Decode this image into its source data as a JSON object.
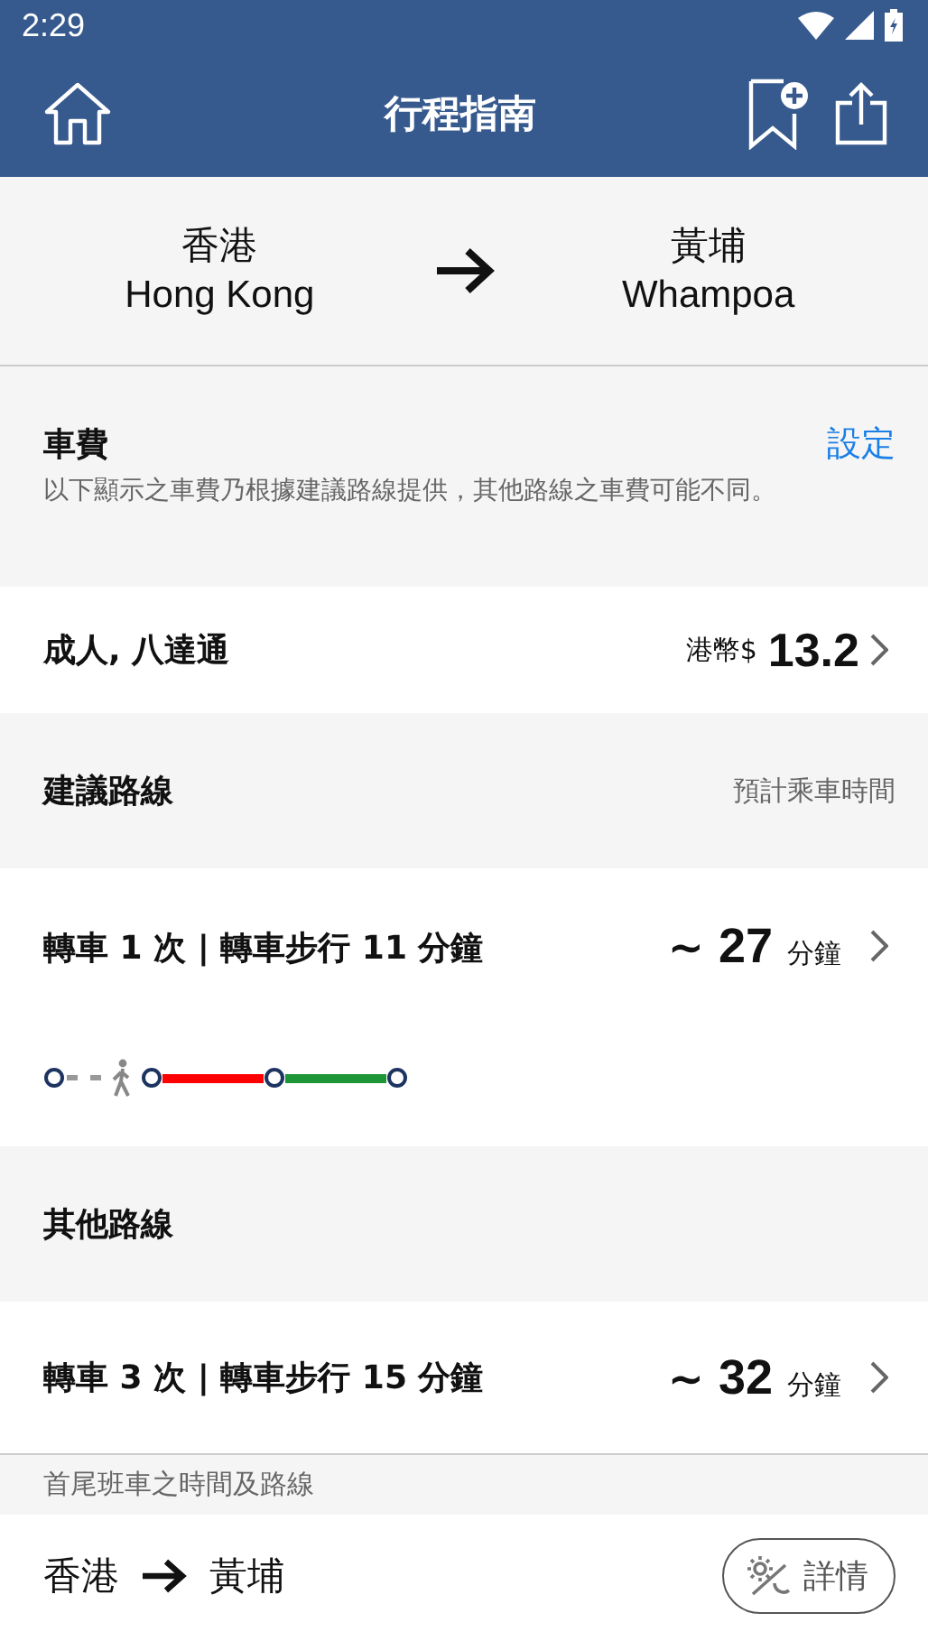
{
  "status_bar": {
    "time": "2:29"
  },
  "app_bar": {
    "title": "行程指南"
  },
  "journey": {
    "origin_zh": "香港",
    "origin_en": "Hong Kong",
    "destination_zh": "黃埔",
    "destination_en": "Whampoa"
  },
  "fare": {
    "title": "車費",
    "action": "設定",
    "note": "以下顯示之車費乃根據建議路線提供，其他路線之車費可能不同。",
    "passenger": "成人, 八達通",
    "currency": "港幣$",
    "amount": "13.2"
  },
  "suggested": {
    "title": "建議路線",
    "hint": "預計乘車時間",
    "route": {
      "summary": "轉車 1 次 | 轉車步行 11 分鐘",
      "prefix": "~",
      "minutes": "27",
      "unit": "分鐘",
      "segments": [
        {
          "kind": "walk"
        },
        {
          "kind": "rail",
          "color": "#ff0000"
        },
        {
          "kind": "rail",
          "color": "#1e9638"
        }
      ]
    }
  },
  "other": {
    "title": "其他路線",
    "routes": [
      {
        "summary": "轉車 3 次 | 轉車步行 15 分鐘",
        "prefix": "~",
        "minutes": "32",
        "unit": "分鐘"
      }
    ]
  },
  "first_last": {
    "title": "首尾班車之時間及路線",
    "origin": "香港",
    "destination": "黃埔",
    "button": "詳情"
  }
}
